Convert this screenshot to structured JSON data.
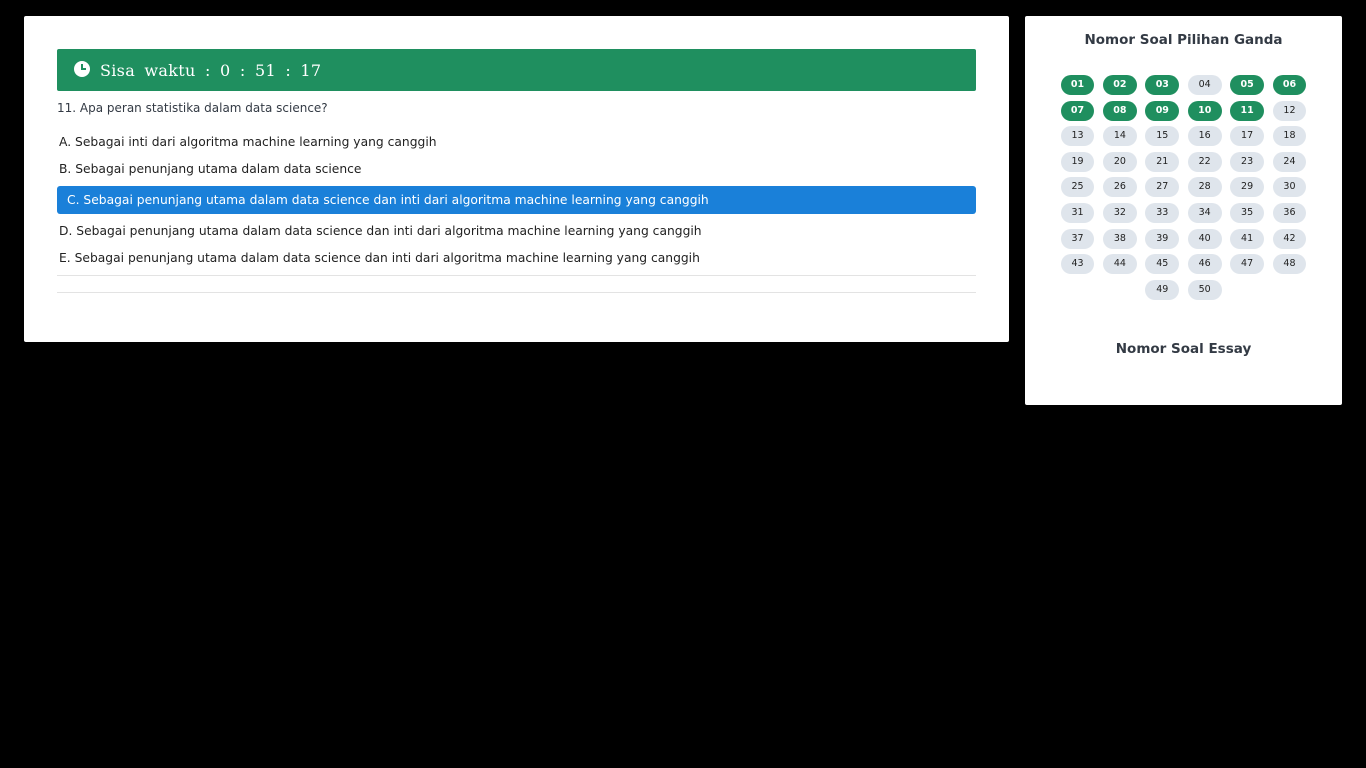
{
  "timer": {
    "label": "Sisa waktu : 0 : 51 : 17"
  },
  "question": {
    "text": "11. Apa peran statistika dalam data science?"
  },
  "options": [
    {
      "text": "A. Sebagai inti dari algoritma machine learning yang canggih",
      "selected": false
    },
    {
      "text": "B. Sebagai penunjang utama dalam data science",
      "selected": false
    },
    {
      "text": "C. Sebagai penunjang utama dalam data science dan inti dari algoritma machine learning yang canggih",
      "selected": true
    },
    {
      "text": "D. Sebagai penunjang utama dalam data science dan inti dari algoritma machine learning yang canggih",
      "selected": false
    },
    {
      "text": "E. Sebagai penunjang utama dalam data science dan inti dari algoritma machine learning yang canggih",
      "selected": false
    }
  ],
  "sidebar": {
    "multiple_choice_title": "Nomor Soal Pilihan Ganda",
    "essay_title": "Nomor Soal Essay",
    "numbers": [
      "01",
      "02",
      "03",
      "04",
      "05",
      "06",
      "07",
      "08",
      "09",
      "10",
      "11",
      "12",
      "13",
      "14",
      "15",
      "16",
      "17",
      "18",
      "19",
      "20",
      "21",
      "22",
      "23",
      "24",
      "25",
      "26",
      "27",
      "28",
      "29",
      "30",
      "31",
      "32",
      "33",
      "34",
      "35",
      "36",
      "37",
      "38",
      "39",
      "40",
      "41",
      "42",
      "43",
      "44",
      "45",
      "46",
      "47",
      "48",
      "49",
      "50"
    ],
    "answered": [
      "01",
      "02",
      "03",
      "05",
      "06",
      "07",
      "08",
      "09",
      "10",
      "11"
    ]
  },
  "colors": {
    "answered": "#1f8f5f",
    "unanswered": "#dfe5ec",
    "selected_option": "#1a80d9",
    "timer_bar": "#1f8f5f"
  }
}
